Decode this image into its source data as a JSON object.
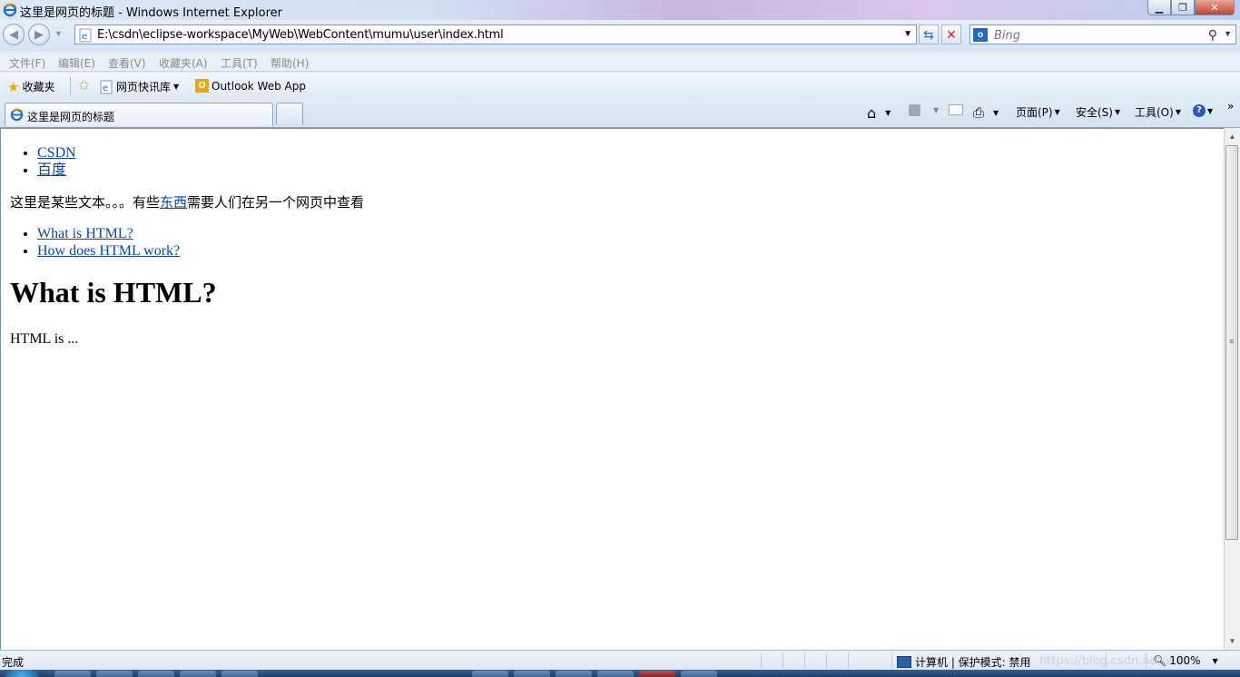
{
  "window": {
    "title": "这里是网页的标题 - Windows Internet Explorer"
  },
  "toolbar": {
    "address": "E:\\csdn\\eclipse-workspace\\MyWeb\\WebContent\\mumu\\user\\index.html",
    "search_placeholder": "Bing"
  },
  "menu": [
    "文件(F)",
    "编辑(E)",
    "查看(V)",
    "收藏夹(A)",
    "工具(T)",
    "帮助(H)"
  ],
  "favorites": {
    "label": "收藏夹",
    "items": [
      "网页快讯库",
      "Outlook Web App"
    ]
  },
  "tab": {
    "label": "这里是网页的标题"
  },
  "commands": {
    "page": "页面(P)",
    "safety": "安全(S)",
    "tools": "工具(O)"
  },
  "page": {
    "links1": [
      "CSDN",
      "百度"
    ],
    "para_before": "这里是某些文本。。。有些",
    "para_link": "东西",
    "para_after": "需要人们在另一个网页中查看",
    "links2": [
      "What is HTML?",
      "How does HTML work?"
    ],
    "heading": "What is HTML?",
    "body_text": "HTML is ..."
  },
  "status": {
    "text": "完成",
    "zone": "计算机 | 保护模式: 禁用",
    "zoom": "100%",
    "watermark": "https://blog.csdn.net/wei..."
  },
  "colors": {
    "link": "#0645ad",
    "ie_blue": "#1d6cc1"
  }
}
